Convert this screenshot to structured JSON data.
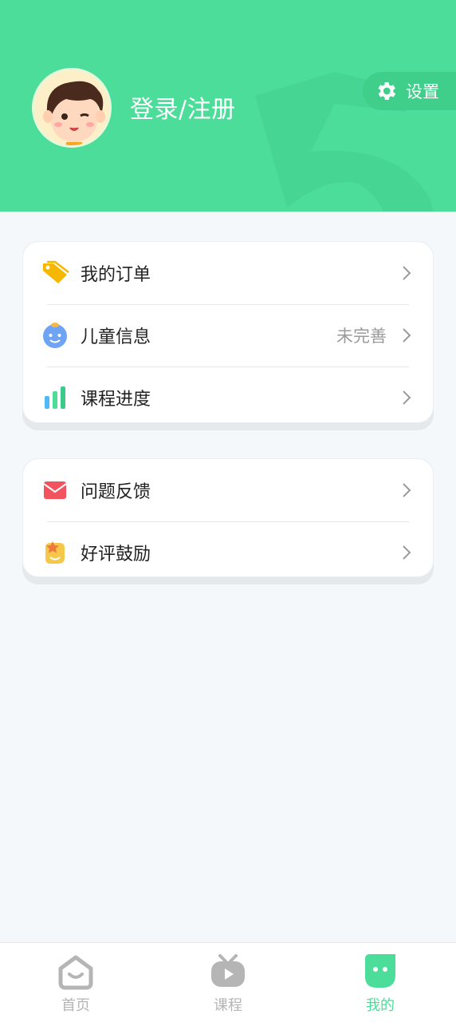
{
  "header": {
    "login_label": "登录/注册",
    "settings_label": "设置",
    "bg_color": "#4ddd9a",
    "avatar": "boy-avatar"
  },
  "menu_group_1": [
    {
      "label": "我的订单",
      "icon": "tag-icon",
      "extra": ""
    },
    {
      "label": "儿童信息",
      "icon": "child-face-icon",
      "extra": "未完善"
    },
    {
      "label": "课程进度",
      "icon": "bar-chart-icon",
      "extra": ""
    }
  ],
  "menu_group_2": [
    {
      "label": "问题反馈",
      "icon": "envelope-icon",
      "extra": ""
    },
    {
      "label": "好评鼓励",
      "icon": "star-badge-icon",
      "extra": ""
    }
  ],
  "tabbar": {
    "tabs": [
      {
        "label": "首页",
        "icon": "home-icon",
        "active": false
      },
      {
        "label": "课程",
        "icon": "tv-play-icon",
        "active": false
      },
      {
        "label": "我的",
        "icon": "profile-icon",
        "active": true
      }
    ],
    "active_color": "#4ddd9a",
    "inactive_color": "#b5b5b5"
  }
}
